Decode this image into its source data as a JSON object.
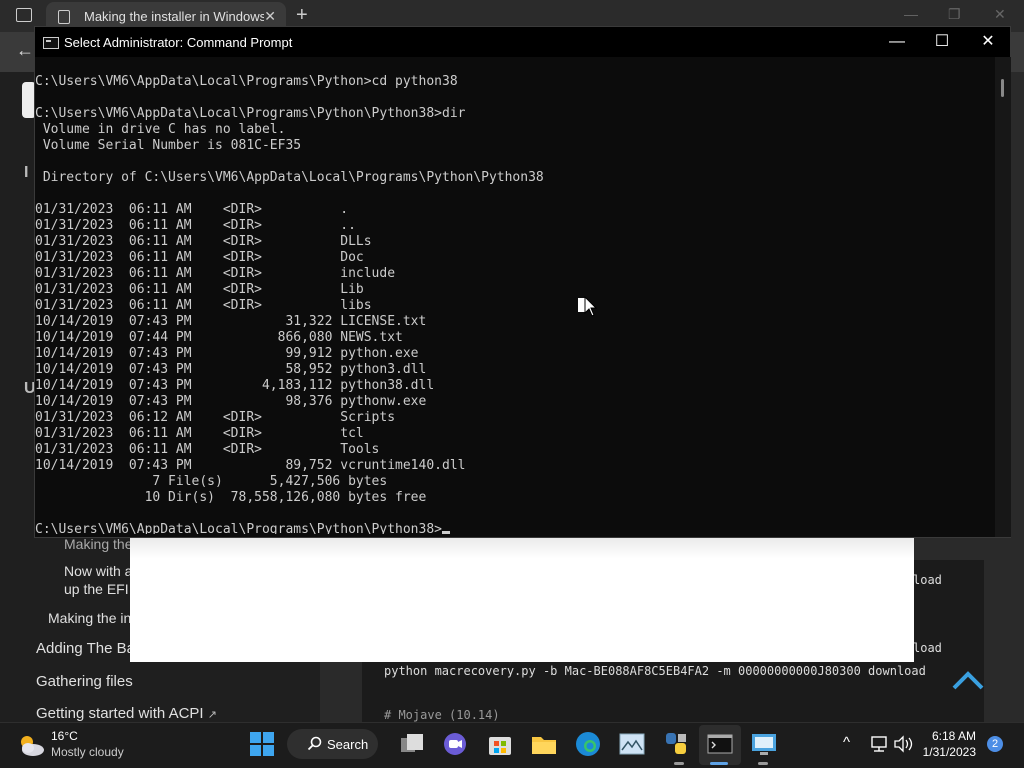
{
  "browser": {
    "tab_title": "Making the installer in Windows",
    "tab_close": "✕",
    "new_tab": "+",
    "back": "←"
  },
  "page": {
    "left_letters": [
      "I",
      "U"
    ],
    "nav": [
      "Making the",
      "Now with a",
      "up the EFI",
      "Making the in",
      "Adding The Ba",
      "Gathering files",
      "Getting started with ACPI"
    ],
    "code_lines": [
      "load",
      "load",
      "python macrecovery.py -b Mac-BE088AF8C5EB4FA2 -m 00000000000J80300 download",
      "# Mojave (10.14)"
    ]
  },
  "cmd": {
    "title": "Select Administrator:  Command Prompt",
    "lines": [
      "C:\\Users\\VM6\\AppData\\Local\\Programs\\Python>cd python38",
      "",
      "C:\\Users\\VM6\\AppData\\Local\\Programs\\Python\\Python38>dir",
      " Volume in drive C has no label.",
      " Volume Serial Number is 081C-EF35",
      "",
      " Directory of C:\\Users\\VM6\\AppData\\Local\\Programs\\Python\\Python38",
      "",
      "01/31/2023  06:11 AM    <DIR>          .",
      "01/31/2023  06:11 AM    <DIR>          ..",
      "01/31/2023  06:11 AM    <DIR>          DLLs",
      "01/31/2023  06:11 AM    <DIR>          Doc",
      "01/31/2023  06:11 AM    <DIR>          include",
      "01/31/2023  06:11 AM    <DIR>          Lib",
      "01/31/2023  06:11 AM    <DIR>          libs",
      "10/14/2019  07:43 PM            31,322 LICENSE.txt",
      "10/14/2019  07:44 PM           866,080 NEWS.txt",
      "10/14/2019  07:43 PM            99,912 python.exe",
      "10/14/2019  07:43 PM            58,952 python3.dll",
      "10/14/2019  07:43 PM         4,183,112 python38.dll",
      "10/14/2019  07:43 PM            98,376 pythonw.exe",
      "01/31/2023  06:12 AM    <DIR>          Scripts",
      "01/31/2023  06:11 AM    <DIR>          tcl",
      "01/31/2023  06:11 AM    <DIR>          Tools",
      "10/14/2019  07:43 PM            89,752 vcruntime140.dll",
      "               7 File(s)      5,427,506 bytes",
      "              10 Dir(s)  78,558,126,080 bytes free",
      ""
    ],
    "prompt": "C:\\Users\\VM6\\AppData\\Local\\Programs\\Python\\Python38>",
    "minimize": "—",
    "maximize": "☐",
    "close": "✕"
  },
  "taskbar": {
    "weather_temp": "16°C",
    "weather_condition": "Mostly cloudy",
    "search_label": "Search",
    "time": "6:18 AM",
    "date": "1/31/2023",
    "notification_count": "2",
    "tray_chevron": "^"
  },
  "colors": {
    "cmd_bg": "#0c0c0c",
    "cmd_text": "#cccccc",
    "taskbar_bg": "#1c1c1c",
    "accent": "#4d8ee6"
  }
}
